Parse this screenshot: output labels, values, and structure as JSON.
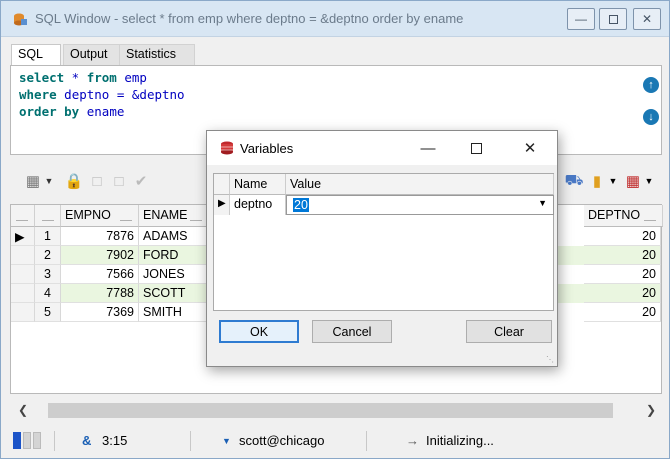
{
  "window": {
    "title": "SQL Window - select * from emp where deptno = &deptno order by ename"
  },
  "tabs": [
    {
      "label": "SQL"
    },
    {
      "label": "Output"
    },
    {
      "label": "Statistics"
    }
  ],
  "sql": {
    "line1_kw": "select",
    "line1_rest": " * ",
    "line1_kw2": "from",
    "line1_tail": " emp",
    "line2_kw": "where",
    "line2_rest": " deptno = &deptno",
    "line3_kw": "order by",
    "line3_rest": " ename"
  },
  "grid": {
    "columns": [
      "EMPNO",
      "ENAME",
      "DEPTNO"
    ],
    "rows": [
      {
        "num": "1",
        "empno": "7876",
        "ename": "ADAMS",
        "deptno": "20"
      },
      {
        "num": "2",
        "empno": "7902",
        "ename": "FORD",
        "deptno": "20"
      },
      {
        "num": "3",
        "empno": "7566",
        "ename": "JONES",
        "deptno": "20"
      },
      {
        "num": "4",
        "empno": "7788",
        "ename": "SCOTT",
        "deptno": "20"
      },
      {
        "num": "5",
        "empno": "7369",
        "ename": "SMITH",
        "deptno": "20"
      }
    ]
  },
  "statusbar": {
    "position": "3:15",
    "position_prefix": "&",
    "connection": "scott@chicago",
    "state": "Initializing..."
  },
  "dialog": {
    "title": "Variables",
    "col_name": "Name",
    "col_value": "Value",
    "var_name": "deptno",
    "var_value": "20",
    "ok": "OK",
    "cancel": "Cancel",
    "clear": "Clear"
  },
  "colors": {
    "accent": "#0078d7",
    "alt_row": "#eaf6e0",
    "keyword": "#007070",
    "identifier": "#0000c0"
  }
}
